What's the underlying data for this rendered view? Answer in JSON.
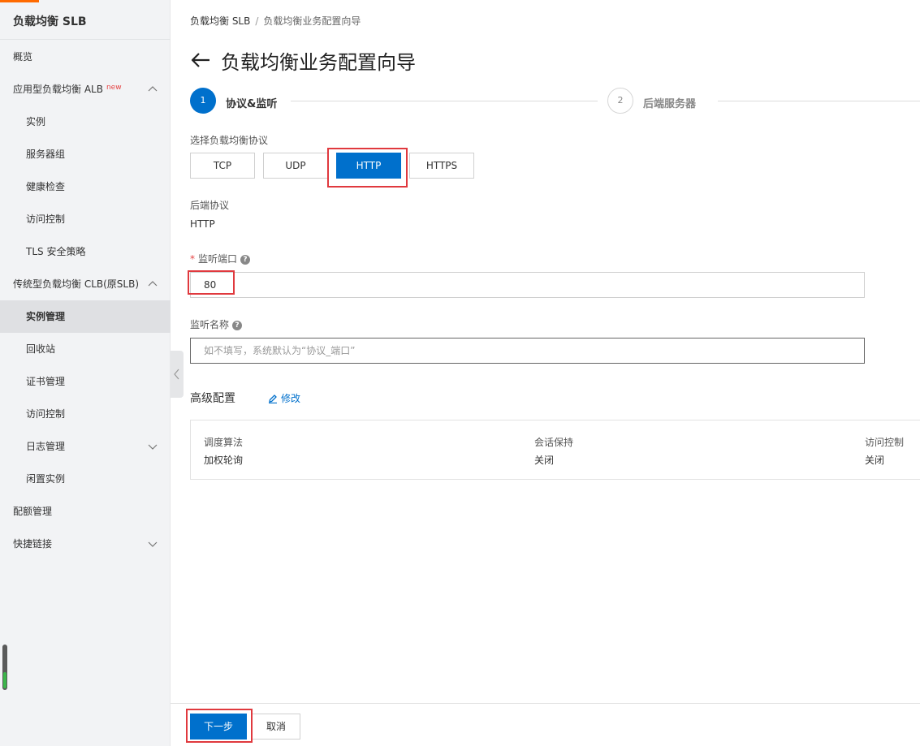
{
  "sidebar": {
    "brand": "负载均衡 SLB",
    "items": [
      {
        "label": "概览"
      },
      {
        "label": "应用型负载均衡 ALB",
        "tag": "new"
      },
      {
        "label": "实例"
      },
      {
        "label": "服务器组"
      },
      {
        "label": "健康检查"
      },
      {
        "label": "访问控制"
      },
      {
        "label": "TLS 安全策略"
      },
      {
        "label": "传统型负载均衡 CLB(原SLB)"
      },
      {
        "label": "实例管理"
      },
      {
        "label": "回收站"
      },
      {
        "label": "证书管理"
      },
      {
        "label": "访问控制"
      },
      {
        "label": "日志管理"
      },
      {
        "label": "闲置实例"
      },
      {
        "label": "配额管理"
      },
      {
        "label": "快捷链接"
      }
    ]
  },
  "breadcrumb": {
    "root": "负载均衡 SLB",
    "separator": "/",
    "current": "负载均衡业务配置向导"
  },
  "page_title": "负载均衡业务配置向导",
  "steps": [
    {
      "number": "1",
      "label": "协议&监听"
    },
    {
      "number": "2",
      "label": "后端服务器"
    }
  ],
  "form": {
    "protocol_label": "选择负载均衡协议",
    "protocols": [
      "TCP",
      "UDP",
      "HTTP",
      "HTTPS"
    ],
    "selected_protocol": "HTTP",
    "backend_protocol_label": "后端协议",
    "backend_protocol_value": "HTTP",
    "port_required_mark": "*",
    "port_label": "监听端口",
    "port_value": "80",
    "name_label": "监听名称",
    "name_placeholder": "如不填写，系统默认为“协议_端口”",
    "help_glyph": "?"
  },
  "advanced": {
    "title": "高级配置",
    "edit_label": "修改",
    "columns": [
      {
        "key": "调度算法",
        "value": "加权轮询"
      },
      {
        "key": "会话保持",
        "value": "关闭"
      },
      {
        "key": "访问控制",
        "value": "关闭"
      }
    ]
  },
  "footer": {
    "next_label": "下一步",
    "cancel_label": "取消"
  },
  "colors": {
    "primary": "#0070cc",
    "highlight": "#e0393e",
    "brand_accent": "#ff6a00"
  }
}
